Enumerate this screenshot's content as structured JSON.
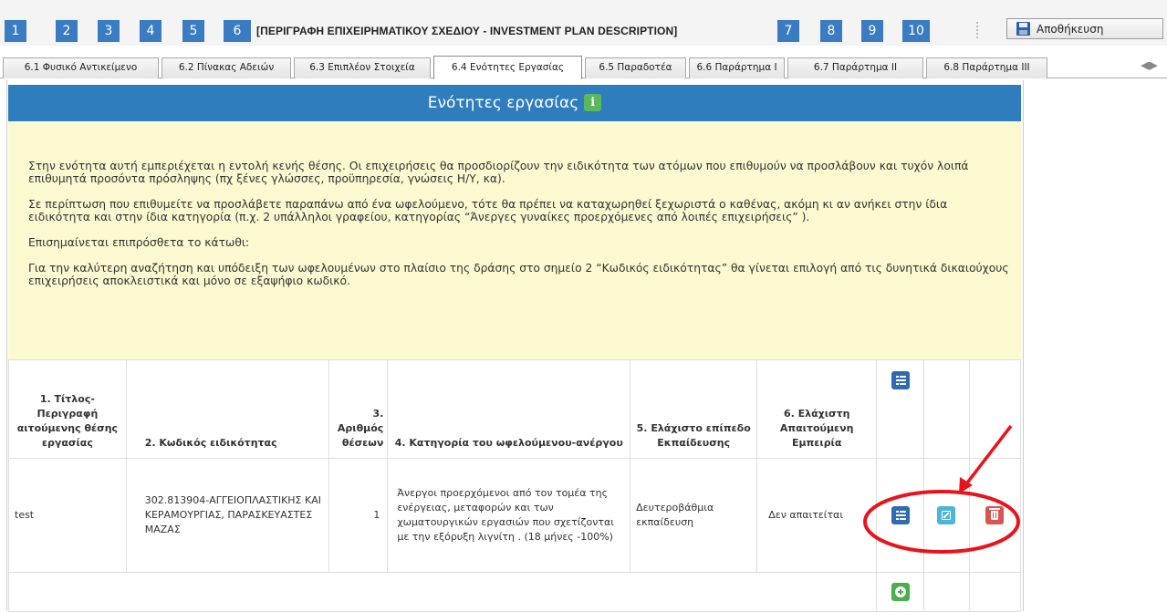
{
  "steps": {
    "s1": "1",
    "s2": "2",
    "s3": "3",
    "s4": "4",
    "s5": "5",
    "s6": "6",
    "title": "[ΠΕΡΙΓΡΑΦΗ ΕΠΙΧΕΙΡΗΜΑΤΙΚΟΥ ΣΧΕΔΙΟΥ - INVESTMENT PLAN DESCRIPTION]",
    "s7": "7",
    "s8": "8",
    "s9": "9",
    "s10": "10"
  },
  "toolbar": {
    "save_label": "Αποθήκευση",
    "save_icon": "floppy-disk-icon"
  },
  "tabs": [
    {
      "label": "6.1 Φυσικό Αντικείμενο"
    },
    {
      "label": "6.2 Πίνακας Αδειών"
    },
    {
      "label": "6.3 Επιπλέον Στοιχεία"
    },
    {
      "label": "6.4 Ενότητες Εργασίας",
      "active": true
    },
    {
      "label": "6.5 Παραδοτέα"
    },
    {
      "label": "6.6 Παράρτημα Ι"
    },
    {
      "label": "6.7 Παράρτημα ΙΙ"
    },
    {
      "label": "6.8 Παράρτημα ΙΙΙ"
    }
  ],
  "panel": {
    "title": "Ενότητες εργασίας",
    "info_icon": "info-icon",
    "notes": [
      "Στην ενότητα αυτή εμπεριέχεται η εντολή κενής θέσης. Οι επιχειρήσεις θα προσδιορίζουν την ειδικότητα των ατόμων που επιθυμούν να προσλάβουν και τυχόν λοιπά επιθυμητά προσόντα πρόσληψης (πχ ξένες γλώσσες, προϋπηρεσία, γνώσεις Η/Υ, κα).",
      "Σε περίπτωση που επιθυμείτε να προσλάβετε παραπάνω από ένα ωφελούμενο, τότε θα πρέπει να καταχωρηθεί ξεχωριστά ο καθένας, ακόμη κι αν ανήκει στην ίδια ειδικότητα και στην ίδια κατηγορία (π.χ. 2 υπάλληλοι γραφείου, κατηγορίας “Άνεργες γυναίκες προερχόμενες από λοιπές επιχειρήσεις” ).",
      "Επισημαίνεται επιπρόσθετα το κάτωθι:",
      "Για την καλύτερη αναζήτηση και υπόδειξη των ωφελουμένων στο πλαίσιο της δράσης στο σημείο 2 “Κωδικός ειδικότητας” θα γίνεται επιλογή από τις δυνητικά δικαιούχους επιχειρήσεις αποκλειστικά και μόνο σε εξαψήφιο κωδικό."
    ]
  },
  "table": {
    "headers": {
      "h1": "1. Τίτλος-Περιγραφή αιτούμενης θέσης εργασίας",
      "h2": "2. Κωδικός ειδικότητας",
      "h3": "3. Αριθμός θέσεων",
      "h4": "4. Κατηγορία του ωφελούμενου-ανέργου",
      "h5": "5. Ελάχιστο επίπεδο Εκπαίδευσης",
      "h6": "6. Ελάχιστη Απαιτούμενη Εμπειρία"
    },
    "rows": [
      {
        "title": "test",
        "code": "302.813904-ΑΓΓΕΙΟΠΛΑΣΤΙΚΗΣ ΚΑΙ ΚΕΡΑΜΟΥΡΓΙΑΣ, ΠΑΡΑΣΚΕΥΑΣΤΕΣ ΜΑΖΑΣ",
        "positions": "1",
        "category": "Άνεργοι προερχόμενοι από τον τομέα της ενέργειας, μεταφορών και των χωματουργικών εργασιών που σχετίζονται με την εξόρυξη λιγνίτη . (18 μήνες -100%)",
        "education": "Δευτεροβάθμια εκπαίδευση",
        "experience": "Δεν απαιτείται"
      }
    ]
  },
  "colors": {
    "step_blue": "#3a7cc2",
    "header_blue": "#2f7dbd",
    "notes_bg": "#fbf9d0",
    "annotation_red": "#e8141c",
    "view_btn": "#2e6bb3",
    "edit_btn": "#4cb4d9",
    "delete_btn": "#d9534f",
    "add_btn": "#4cae4c"
  }
}
